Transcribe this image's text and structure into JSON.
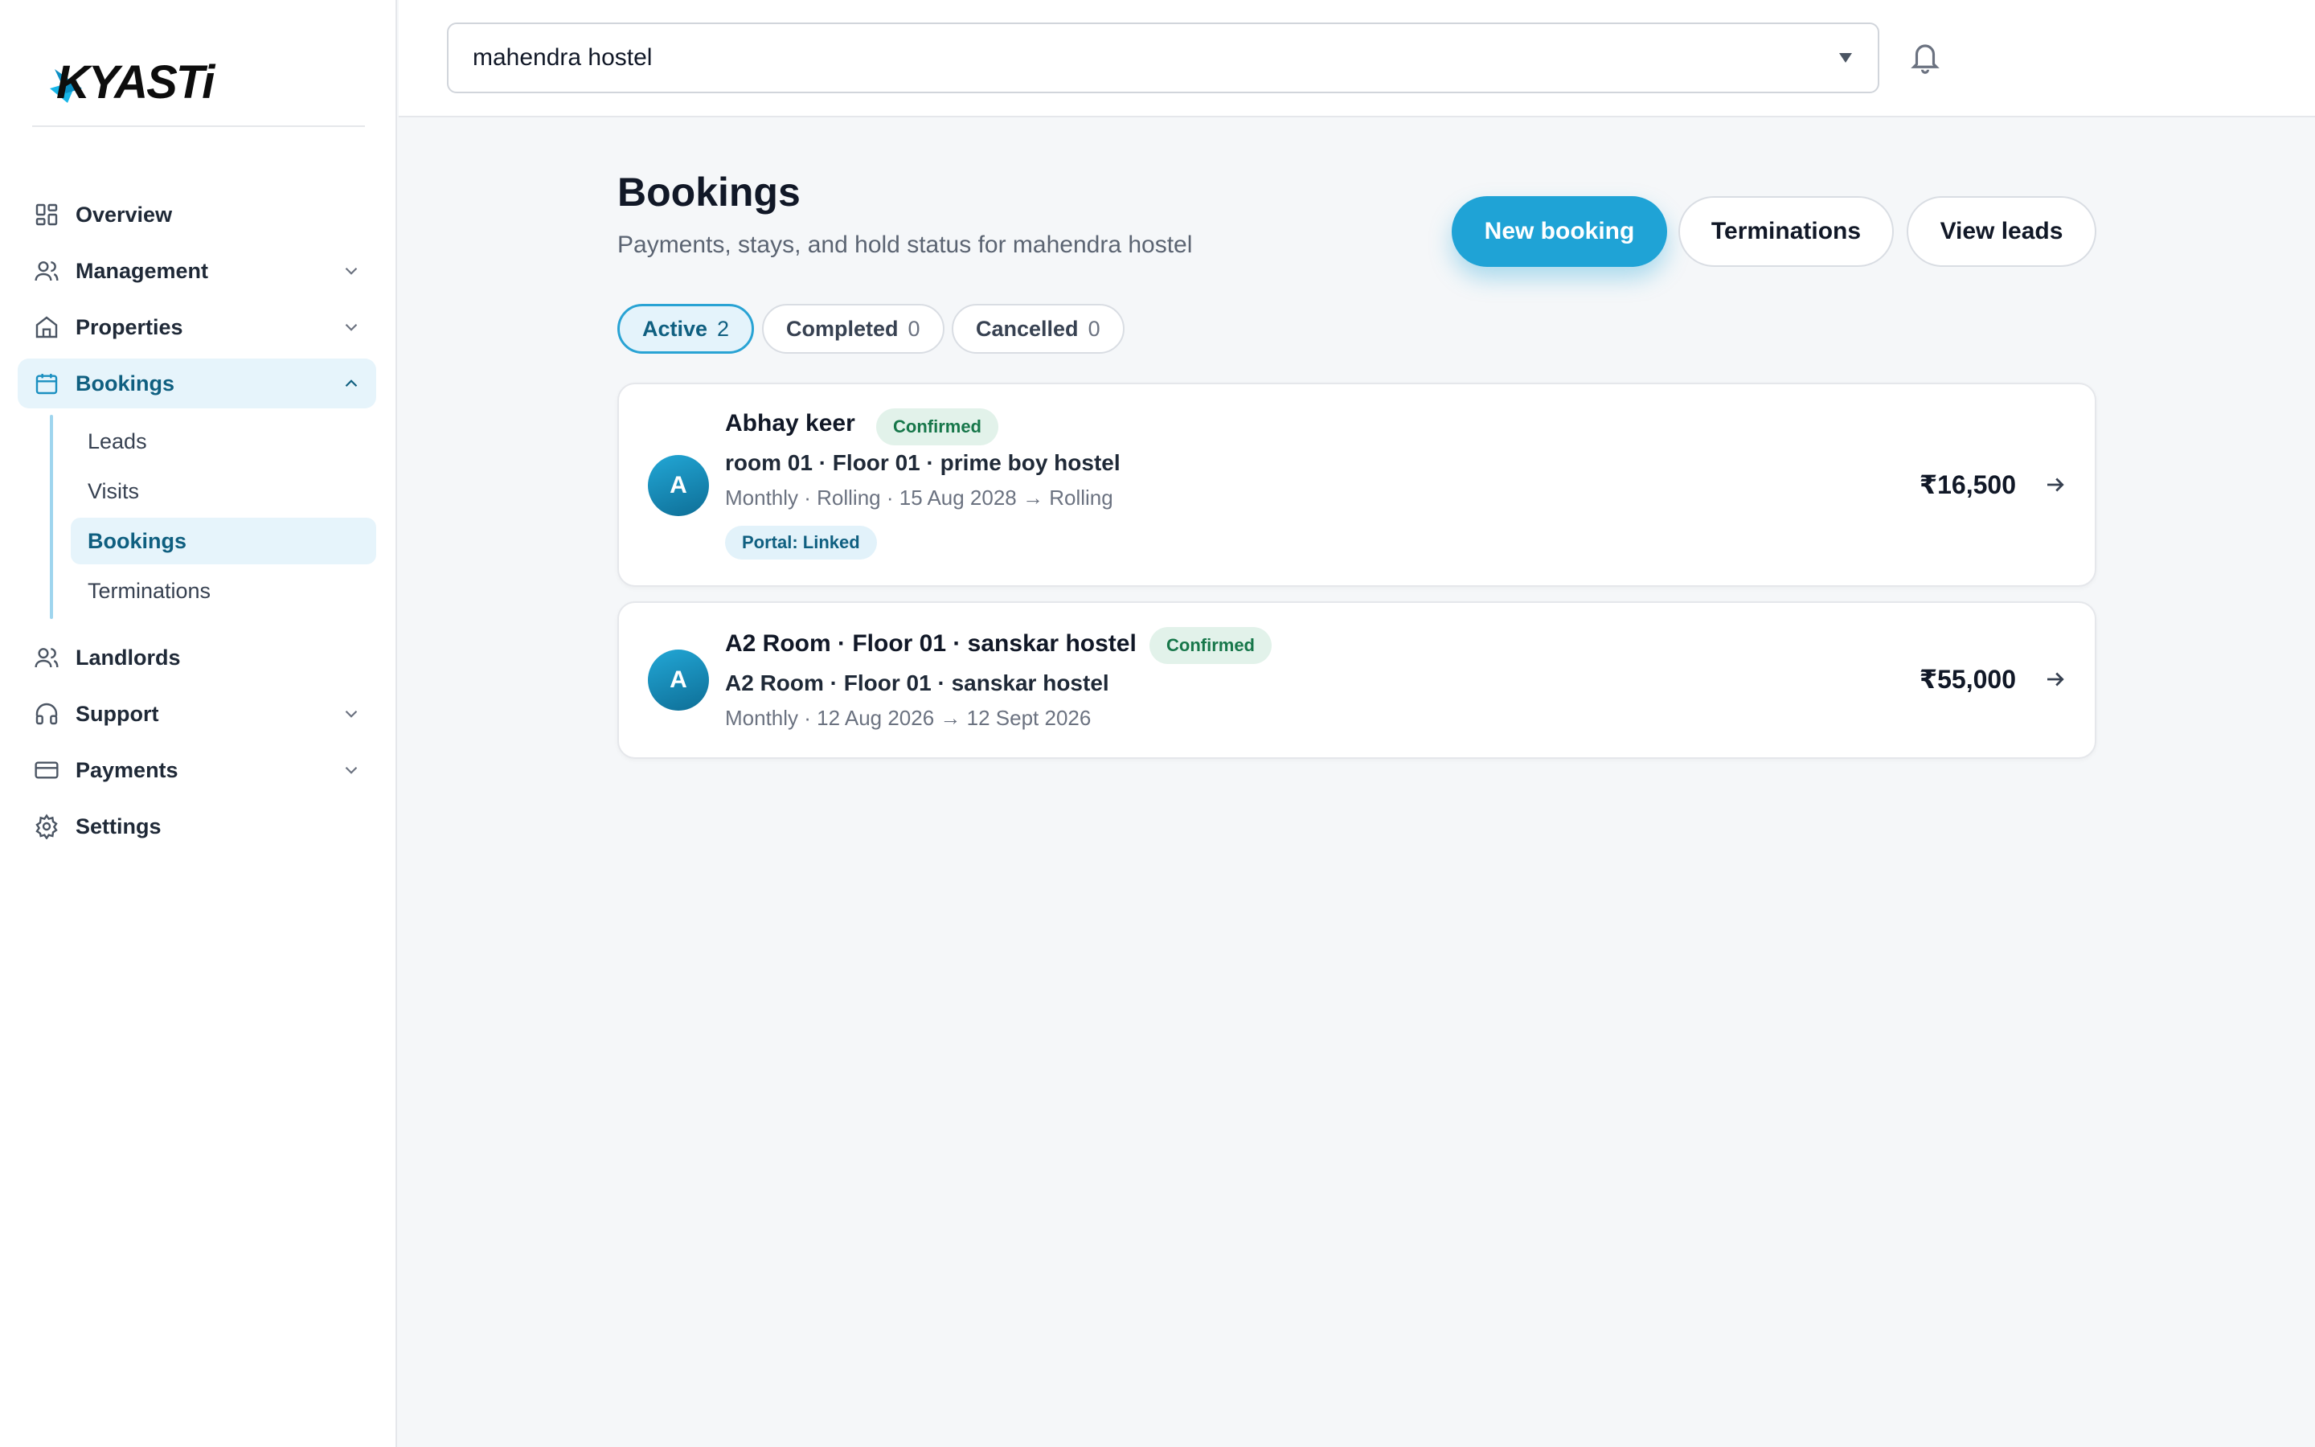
{
  "brand": {
    "logo_text": "KYASTi",
    "accent": "#1fa3d6"
  },
  "sidebar": {
    "items": [
      {
        "label": "Overview",
        "icon": "grid-icon",
        "expandable": false
      },
      {
        "label": "Management",
        "icon": "users-icon",
        "expandable": true
      },
      {
        "label": "Properties",
        "icon": "home-icon",
        "expandable": true
      },
      {
        "label": "Bookings",
        "icon": "calendar-icon",
        "expandable": true,
        "expanded": true,
        "active": true
      },
      {
        "label": "Landlords",
        "icon": "users-icon",
        "expandable": false
      },
      {
        "label": "Support",
        "icon": "headphones-icon",
        "expandable": true
      },
      {
        "label": "Payments",
        "icon": "credit-card-icon",
        "expandable": true
      },
      {
        "label": "Settings",
        "icon": "gear-icon",
        "expandable": false
      }
    ],
    "bookings_sub": [
      {
        "label": "Leads"
      },
      {
        "label": "Visits"
      },
      {
        "label": "Bookings",
        "active": true
      },
      {
        "label": "Terminations"
      }
    ]
  },
  "topbar": {
    "property_selected": "mahendra hostel",
    "bell_icon": "bell-icon"
  },
  "page": {
    "title": "Bookings",
    "subtitle": "Payments, stays, and hold status for mahendra hostel",
    "actions": {
      "new_booking": "New booking",
      "terminations": "Terminations",
      "view_leads": "View leads"
    },
    "tabs": [
      {
        "label": "Active",
        "count": "2",
        "active": true
      },
      {
        "label": "Completed",
        "count": "0"
      },
      {
        "label": "Cancelled",
        "count": "0"
      }
    ]
  },
  "bookings": [
    {
      "avatar": "A",
      "name": "Abhay keer",
      "status": "Confirmed",
      "room": "room 01 · Floor 01 · prime boy hostel",
      "meta": "Monthly · Rolling · 15 Aug 2028 → Rolling",
      "portal": "Portal: Linked",
      "amount": "₹16,500"
    },
    {
      "avatar": "A",
      "name": "A2 Room · Floor 01 · sanskar hostel",
      "status": "Confirmed",
      "room": "A2 Room · Floor 01 · sanskar hostel",
      "meta": "Monthly · 12 Aug 2026 → 12 Sept 2026",
      "amount": "₹55,000"
    }
  ]
}
